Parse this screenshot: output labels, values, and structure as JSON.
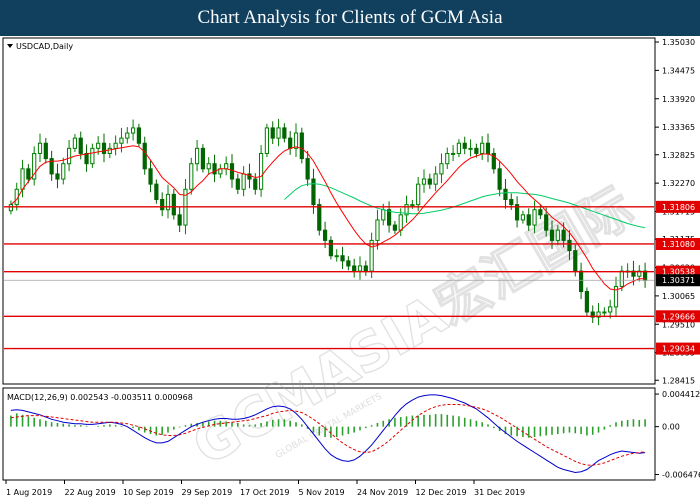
{
  "header": {
    "title": "Chart Analysis for Clients of GCM Asia"
  },
  "watermark": {
    "text": "GCMASIA宏汇国际",
    "subtext": "GLOBAL CAPITAL MARKETS"
  },
  "colors": {
    "header_bg": "#10405e",
    "candle_up": "#008000",
    "candle_down": "#006400",
    "ma_fast": "#ff0000",
    "ma_slow": "#00cc66",
    "level_line": "#e00000",
    "level_box": "#e00000",
    "current_box": "#000000",
    "macd_hist": "#2ca02c",
    "macd_line": "#0000cc",
    "macd_signal": "#e00000"
  },
  "chart_data": [
    {
      "type": "candlestick",
      "title": "USDCAD,Daily",
      "symbol": "USDCAD",
      "timeframe": "Daily",
      "ylim": [
        1.2842,
        1.3503
      ],
      "y_ticks": [
        "1.35030",
        "1.34475",
        "1.33920",
        "1.33365",
        "1.32825",
        "1.32270",
        "1.31715",
        "1.31175",
        "1.30620",
        "1.30065",
        "1.29510",
        "1.28955",
        "1.28415"
      ],
      "x_ticks": [
        "1 Aug 2019",
        "22 Aug 2019",
        "10 Sep 2019",
        "29 Sep 2019",
        "17 Oct 2019",
        "5 Nov 2019",
        "24 Nov 2019",
        "12 Dec 2019",
        "31 Dec 2019"
      ],
      "levels": [
        {
          "value": 1.31806,
          "label": "1.31806"
        },
        {
          "value": 1.3108,
          "label": "1.31080"
        },
        {
          "value": 1.30538,
          "label": "1.30538"
        },
        {
          "value": 1.29666,
          "label": "1.29666"
        },
        {
          "value": 1.29034,
          "label": "1.29034"
        }
      ],
      "current_price": {
        "value": 1.30371,
        "label": "1.30371"
      },
      "close_series": [
        1.3185,
        1.3215,
        1.3255,
        1.3235,
        1.3285,
        1.3305,
        1.3275,
        1.3245,
        1.3235,
        1.3265,
        1.3295,
        1.3315,
        1.3285,
        1.3265,
        1.3295,
        1.3305,
        1.3285,
        1.3295,
        1.3305,
        1.3315,
        1.3325,
        1.3335,
        1.3305,
        1.3255,
        1.3225,
        1.3195,
        1.3175,
        1.3205,
        1.3165,
        1.3145,
        1.3215,
        1.3265,
        1.3295,
        1.3255,
        1.3265,
        1.3245,
        1.3255,
        1.3265,
        1.3235,
        1.3215,
        1.3245,
        1.3235,
        1.3215,
        1.3285,
        1.3335,
        1.3315,
        1.3335,
        1.3315,
        1.3295,
        1.3325,
        1.3275,
        1.3235,
        1.3185,
        1.3135,
        1.3115,
        1.3085,
        1.3085,
        1.3075,
        1.3065,
        1.3055,
        1.3065,
        1.3055,
        1.3115,
        1.3155,
        1.3175,
        1.3145,
        1.3135,
        1.3165,
        1.3185,
        1.3185,
        1.3225,
        1.3235,
        1.3225,
        1.3245,
        1.3265,
        1.3285,
        1.3285,
        1.3305,
        1.3295,
        1.3295,
        1.3285,
        1.3305,
        1.3285,
        1.3255,
        1.3215,
        1.3195,
        1.3185,
        1.3155,
        1.3165,
        1.3145,
        1.3175,
        1.3165,
        1.3135,
        1.3115,
        1.3135,
        1.3115,
        1.3095,
        1.3055,
        1.3015,
        1.2975,
        1.2965,
        1.2975,
        1.2975,
        1.2985,
        1.3025,
        1.3055,
        1.3055,
        1.3045,
        1.3055,
        1.3037
      ],
      "ma_fast": [
        1.3185,
        1.3195,
        1.3215,
        1.323,
        1.3245,
        1.326,
        1.3268,
        1.327,
        1.327,
        1.3272,
        1.3276,
        1.328,
        1.3282,
        1.3284,
        1.3286,
        1.3288,
        1.329,
        1.3292,
        1.3294,
        1.3296,
        1.3298,
        1.33,
        1.3298,
        1.3288,
        1.3272,
        1.3255,
        1.3238,
        1.3228,
        1.3218,
        1.3205,
        1.3203,
        1.321,
        1.3222,
        1.3232,
        1.3245,
        1.325,
        1.3255,
        1.3255,
        1.3252,
        1.3248,
        1.3245,
        1.3242,
        1.3238,
        1.324,
        1.3255,
        1.3268,
        1.328,
        1.329,
        1.3295,
        1.3298,
        1.3295,
        1.3285,
        1.327,
        1.325,
        1.323,
        1.3208,
        1.3188,
        1.317,
        1.3152,
        1.3135,
        1.312,
        1.3108,
        1.3102,
        1.3105,
        1.3112,
        1.3118,
        1.3125,
        1.3135,
        1.3145,
        1.3155,
        1.3168,
        1.3182,
        1.3195,
        1.3208,
        1.322,
        1.3232,
        1.3245,
        1.3258,
        1.3268,
        1.3276,
        1.328,
        1.3284,
        1.3284,
        1.328,
        1.327,
        1.3258,
        1.3245,
        1.323,
        1.3218,
        1.3205,
        1.3195,
        1.3185,
        1.3172,
        1.316,
        1.3152,
        1.3142,
        1.313,
        1.3115,
        1.3098,
        1.308,
        1.306,
        1.3045,
        1.303,
        1.302,
        1.3018,
        1.3022,
        1.303,
        1.3035,
        1.304,
        1.304
      ],
      "ma_slow": [
        null,
        null,
        null,
        null,
        null,
        null,
        null,
        null,
        null,
        null,
        null,
        null,
        null,
        null,
        null,
        null,
        null,
        null,
        null,
        null,
        null,
        null,
        null,
        null,
        null,
        null,
        null,
        null,
        null,
        null,
        null,
        null,
        null,
        null,
        null,
        null,
        null,
        null,
        null,
        null,
        null,
        null,
        null,
        null,
        null,
        null,
        null,
        1.3195,
        1.3205,
        1.3215,
        1.3222,
        1.3225,
        1.3226,
        1.3225,
        1.3222,
        1.3218,
        1.3213,
        1.3208,
        1.3203,
        1.3198,
        1.3192,
        1.3187,
        1.3182,
        1.3178,
        1.3175,
        1.3172,
        1.317,
        1.3169,
        1.3168,
        1.3167,
        1.3167,
        1.3168,
        1.317,
        1.3172,
        1.3174,
        1.3177,
        1.318,
        1.3184,
        1.3188,
        1.3192,
        1.3196,
        1.32,
        1.3203,
        1.3205,
        1.3207,
        1.3208,
        1.3208,
        1.3208,
        1.3207,
        1.3206,
        1.3205,
        1.3203,
        1.32,
        1.3197,
        1.3194,
        1.3191,
        1.3188,
        1.3184,
        1.318,
        1.3176,
        1.3172,
        1.3168,
        1.3164,
        1.316,
        1.3156,
        1.3152,
        1.3148,
        1.3145,
        1.3142,
        1.314
      ]
    },
    {
      "type": "bar+line",
      "title": "MACD(12,26,9) 0.002543 -0.003511 0.000968",
      "ylim": [
        -0.00668,
        0.00442
      ],
      "y_ticks": [
        "0.004412",
        "0.00",
        "-0.006476"
      ],
      "histogram": [
        0.0015,
        0.0018,
        0.0016,
        0.0014,
        0.0012,
        0.001,
        0.0008,
        0.0006,
        0.0005,
        0.0004,
        0.0003,
        0.0002,
        0.0002,
        0.0001,
        0.0,
        0.0001,
        0.0002,
        0.0003,
        0.0002,
        0.0001,
        0.0,
        -0.0002,
        -0.0005,
        -0.0008,
        -0.001,
        -0.0012,
        -0.0011,
        -0.0008,
        -0.0004,
        -0.0001,
        0.0002,
        0.0004,
        0.0005,
        0.0006,
        0.0007,
        0.0008,
        0.0008,
        0.0007,
        0.0006,
        0.0005,
        0.0003,
        0.0002,
        0.0003,
        0.0005,
        0.0007,
        0.0009,
        0.001,
        0.001,
        0.0008,
        0.0006,
        0.0003,
        -0.0003,
        -0.0008,
        -0.0012,
        -0.0014,
        -0.0015,
        -0.0014,
        -0.0012,
        -0.001,
        -0.0008,
        -0.0005,
        -0.0002,
        0.0002,
        0.0005,
        0.0008,
        0.001,
        0.0012,
        0.0013,
        0.0014,
        0.0015,
        0.0015,
        0.0016,
        0.0016,
        0.0017,
        0.0017,
        0.0016,
        0.0015,
        0.0014,
        0.0012,
        0.001,
        0.0008,
        0.0006,
        0.0003,
        -0.0002,
        -0.0006,
        -0.001,
        -0.0012,
        -0.0013,
        -0.0014,
        -0.0015,
        -0.0014,
        -0.0013,
        -0.0012,
        -0.0011,
        -0.001,
        -0.0009,
        -0.0008,
        -0.0009,
        -0.001,
        -0.0012,
        -0.0011,
        -0.0008,
        -0.0004,
        0.0002,
        0.0006,
        0.0008,
        0.0009,
        0.001,
        0.0009,
        0.001
      ],
      "macd_line": [
        0.0022,
        0.0023,
        0.0022,
        0.002,
        0.0018,
        0.0016,
        0.0013,
        0.001,
        0.0008,
        0.0006,
        0.0005,
        0.0004,
        0.0004,
        0.0003,
        0.0003,
        0.0004,
        0.0005,
        0.0006,
        0.0005,
        0.0003,
        0.0,
        -0.0005,
        -0.001,
        -0.0015,
        -0.0019,
        -0.0022,
        -0.0022,
        -0.002,
        -0.0015,
        -0.001,
        -0.0005,
        0.0,
        0.0003,
        0.0006,
        0.0008,
        0.001,
        0.0011,
        0.0011,
        0.001,
        0.001,
        0.0011,
        0.0013,
        0.0016,
        0.002,
        0.0024,
        0.0027,
        0.0028,
        0.0027,
        0.0024,
        0.0018,
        0.001,
        0.0,
        -0.001,
        -0.002,
        -0.003,
        -0.0038,
        -0.0043,
        -0.0046,
        -0.0047,
        -0.0045,
        -0.004,
        -0.0033,
        -0.0025,
        -0.0015,
        -0.0005,
        0.0005,
        0.0015,
        0.0024,
        0.0031,
        0.0036,
        0.004,
        0.0042,
        0.0043,
        0.0043,
        0.0042,
        0.004,
        0.0038,
        0.0035,
        0.0032,
        0.0028,
        0.0024,
        0.0018,
        0.0012,
        0.0005,
        -0.0002,
        -0.0008,
        -0.0014,
        -0.002,
        -0.0025,
        -0.003,
        -0.0035,
        -0.004,
        -0.0045,
        -0.005,
        -0.0055,
        -0.0058,
        -0.006,
        -0.0062,
        -0.0061,
        -0.0058,
        -0.0052,
        -0.0046,
        -0.0042,
        -0.0038,
        -0.0035,
        -0.0033,
        -0.0034,
        -0.0035,
        -0.0036,
        -0.00351
      ],
      "signal_line": [
        0.0012,
        0.0013,
        0.0014,
        0.0015,
        0.0015,
        0.0015,
        0.0014,
        0.0013,
        0.0012,
        0.0011,
        0.001,
        0.0009,
        0.0008,
        0.0007,
        0.0006,
        0.0006,
        0.0006,
        0.0006,
        0.0006,
        0.0005,
        0.0004,
        0.0002,
        0.0,
        -0.0003,
        -0.0006,
        -0.0009,
        -0.0011,
        -0.0012,
        -0.0012,
        -0.0011,
        -0.0009,
        -0.0006,
        -0.0003,
        -0.0001,
        0.0001,
        0.0003,
        0.0004,
        0.0005,
        0.0006,
        0.0007,
        0.0008,
        0.0009,
        0.0011,
        0.0013,
        0.0015,
        0.0018,
        0.002,
        0.0021,
        0.0022,
        0.0021,
        0.0019,
        0.0015,
        0.001,
        0.0004,
        -0.0002,
        -0.0009,
        -0.0016,
        -0.0022,
        -0.0027,
        -0.0031,
        -0.0034,
        -0.0035,
        -0.0034,
        -0.003,
        -0.0025,
        -0.0019,
        -0.0012,
        -0.0005,
        0.0002,
        0.0009,
        0.0015,
        0.002,
        0.0024,
        0.0027,
        0.0029,
        0.003,
        0.003,
        0.003,
        0.0029,
        0.0028,
        0.0026,
        0.0024,
        0.0021,
        0.0017,
        0.0013,
        0.0008,
        0.0003,
        -0.0002,
        -0.0007,
        -0.0012,
        -0.0017,
        -0.0022,
        -0.0027,
        -0.0031,
        -0.0035,
        -0.0039,
        -0.0043,
        -0.0047,
        -0.005,
        -0.0052,
        -0.0052,
        -0.0051,
        -0.0049,
        -0.0046,
        -0.0043,
        -0.004,
        -0.0038,
        -0.0036,
        -0.0035,
        -0.0034
      ]
    }
  ]
}
